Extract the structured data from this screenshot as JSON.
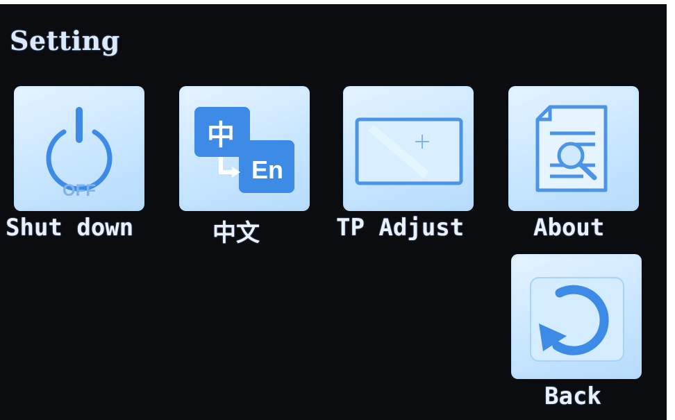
{
  "header": {
    "title": "Setting"
  },
  "items": [
    {
      "label": "Shut down",
      "icon": "power-off-icon",
      "icon_text": "OFF"
    },
    {
      "label": "中文",
      "icon": "language-switch-icon",
      "icon_text_top": "中",
      "icon_text_bottom": "En"
    },
    {
      "label": "TP Adjust",
      "icon": "touch-calibration-icon"
    },
    {
      "label": "About",
      "icon": "document-search-icon"
    },
    {
      "label": "Back",
      "icon": "back-arrow-icon"
    }
  ],
  "colors": {
    "screen_bg": "#0b0c0f",
    "tile_bg": "#cfe9ff",
    "icon": "#3d8be6",
    "text": "#e8f1ff"
  }
}
